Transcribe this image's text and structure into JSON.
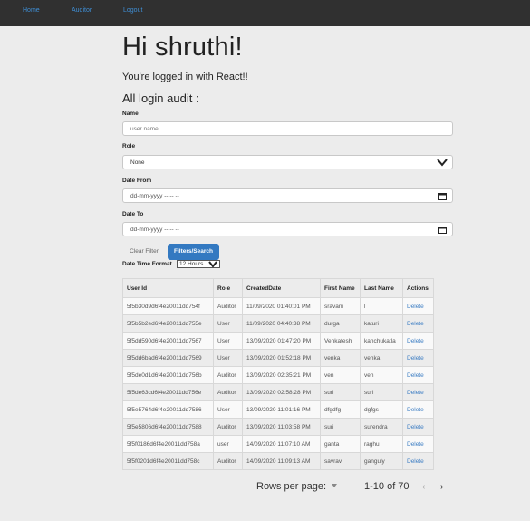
{
  "nav": {
    "items": [
      "Home",
      "Auditor",
      "Logout"
    ],
    "link_color": "#3f8fd6",
    "bg_color": "#303030"
  },
  "greeting": "Hi shruthi!",
  "logged_in": "You're logged in with React!!",
  "audit_title": "All login audit :",
  "filters": {
    "name_label": "Name",
    "name_placeholder": "user name",
    "role_label": "Role",
    "role_value": "None",
    "date_from_label": "Date From",
    "date_from_value": "dd-mm-yyyy --:-- --",
    "date_to_label": "Date To",
    "date_to_value": "dd-mm-yyyy --:-- --",
    "clear_label": "Clear Filter",
    "search_label": "Filters/Search",
    "dtf_label": "Date Time Format",
    "dtf_value": "12 Hours"
  },
  "table": {
    "headers": [
      "User Id",
      "Role",
      "CreatedDate",
      "First Name",
      "Last Name",
      "Actions"
    ],
    "rows": [
      [
        "5f5b30d9d6f4e20011dd754f",
        "Auditor",
        "11/09/2020 01:40:01 PM",
        "sravani",
        "l",
        "Delete"
      ],
      [
        "5f5b5b2ed6f4e20011dd755e",
        "User",
        "11/09/2020 04:40:38 PM",
        "durga",
        "katuri",
        "Delete"
      ],
      [
        "5f5dd590d6f4e20011dd7567",
        "User",
        "13/09/2020 01:47:20 PM",
        "Venkatesh",
        "kanchukatla",
        "Delete"
      ],
      [
        "5f5dd6bad6f4e20011dd7569",
        "User",
        "13/09/2020 01:52:18 PM",
        "venka",
        "venka",
        "Delete"
      ],
      [
        "5f5de0d1d6f4e20011dd756b",
        "Auditor",
        "13/09/2020 02:35:21 PM",
        "ven",
        "ven",
        "Delete"
      ],
      [
        "5f5de63cd6f4e20011dd756e",
        "Auditor",
        "13/09/2020 02:58:28 PM",
        "suri",
        "suri",
        "Delete"
      ],
      [
        "5f5e5764d6f4e20011dd7586",
        "User",
        "13/09/2020 11:01:16 PM",
        "dfgdfg",
        "dgfgs",
        "Delete"
      ],
      [
        "5f5e5806d6f4e20011dd7588",
        "Auditor",
        "13/09/2020 11:03:58 PM",
        "suri",
        "surendra",
        "Delete"
      ],
      [
        "5f5f0186d6f4e20011dd758a",
        "user",
        "14/09/2020 11:07:10 AM",
        "ganta",
        "raghu",
        "Delete"
      ],
      [
        "5f5f0201d6f4e20011dd758c",
        "Auditor",
        "14/09/2020 11:09:13 AM",
        "savrav",
        "ganguly",
        "Delete"
      ]
    ]
  },
  "pager": {
    "rows_label": "Rows per page:",
    "rows_value": "",
    "range": "1-10 of 70",
    "prev": "‹",
    "next": "›"
  }
}
